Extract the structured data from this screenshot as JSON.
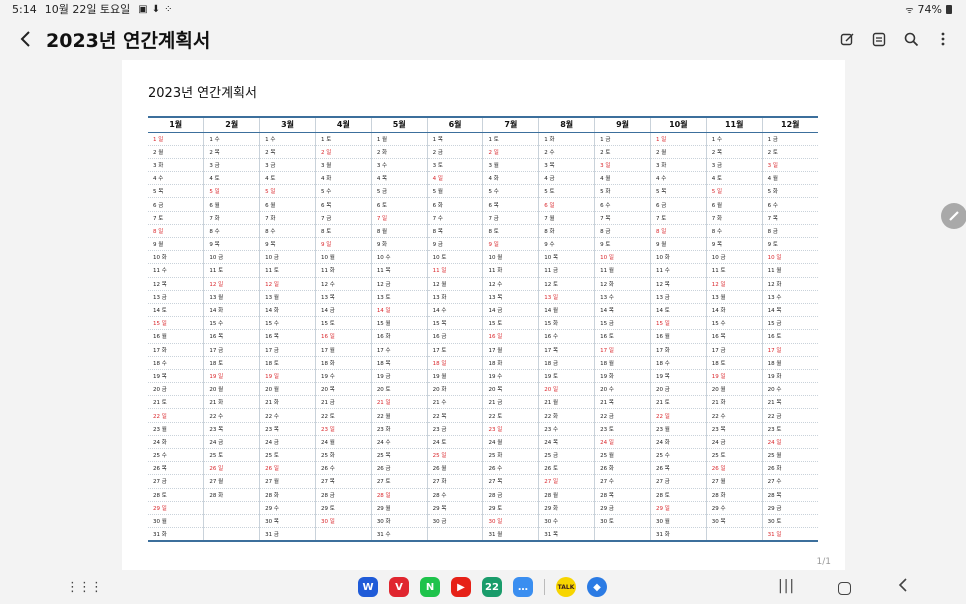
{
  "status": {
    "time": "5:14",
    "date": "10월 22일 토요일",
    "battery": "74%"
  },
  "app_bar": {
    "title": "2023년 연간계획서"
  },
  "document": {
    "title": "2023년  연간계획서",
    "page_indicator": "1/1"
  },
  "calendar": {
    "months": [
      "1월",
      "2월",
      "3월",
      "4월",
      "5월",
      "6월",
      "7월",
      "8월",
      "9월",
      "10월",
      "11월",
      "12월"
    ],
    "rows": [
      [
        "1 일",
        "1 수",
        "1 수",
        "1 토",
        "1 월",
        "1 목",
        "1 토",
        "1 화",
        "1 금",
        "1 일",
        "1 수",
        "1 금"
      ],
      [
        "2 월",
        "2 목",
        "2 목",
        "2 일",
        "2 화",
        "2 금",
        "2 일",
        "2 수",
        "2 토",
        "2 월",
        "2 목",
        "2 토"
      ],
      [
        "3 화",
        "3 금",
        "3 금",
        "3 월",
        "3 수",
        "3 토",
        "3 월",
        "3 목",
        "3 일",
        "3 화",
        "3 금",
        "3 일"
      ],
      [
        "4 수",
        "4 토",
        "4 토",
        "4 화",
        "4 목",
        "4 일",
        "4 화",
        "4 금",
        "4 월",
        "4 수",
        "4 토",
        "4 월"
      ],
      [
        "5 목",
        "5 일",
        "5 일",
        "5 수",
        "5 금",
        "5 월",
        "5 수",
        "5 토",
        "5 화",
        "5 목",
        "5 일",
        "5 화"
      ],
      [
        "6 금",
        "6 월",
        "6 월",
        "6 목",
        "6 토",
        "6 화",
        "6 목",
        "6 일",
        "6 수",
        "6 금",
        "6 월",
        "6 수"
      ],
      [
        "7 토",
        "7 화",
        "7 화",
        "7 금",
        "7 일",
        "7 수",
        "7 금",
        "7 월",
        "7 목",
        "7 토",
        "7 화",
        "7 목"
      ],
      [
        "8 일",
        "8 수",
        "8 수",
        "8 토",
        "8 월",
        "8 목",
        "8 토",
        "8 화",
        "8 금",
        "8 일",
        "8 수",
        "8 금"
      ],
      [
        "9 월",
        "9 목",
        "9 목",
        "9 일",
        "9 화",
        "9 금",
        "9 일",
        "9 수",
        "9 토",
        "9 월",
        "9 목",
        "9 토"
      ],
      [
        "10 화",
        "10 금",
        "10 금",
        "10 월",
        "10 수",
        "10 토",
        "10 월",
        "10 목",
        "10 일",
        "10 화",
        "10 금",
        "10 일"
      ],
      [
        "11 수",
        "11 토",
        "11 토",
        "11 화",
        "11 목",
        "11 일",
        "11 화",
        "11 금",
        "11 월",
        "11 수",
        "11 토",
        "11 월"
      ],
      [
        "12 목",
        "12 일",
        "12 일",
        "12 수",
        "12 금",
        "12 월",
        "12 수",
        "12 토",
        "12 화",
        "12 목",
        "12 일",
        "12 화"
      ],
      [
        "13 금",
        "13 월",
        "13 월",
        "13 목",
        "13 토",
        "13 화",
        "13 목",
        "13 일",
        "13 수",
        "13 금",
        "13 월",
        "13 수"
      ],
      [
        "14 토",
        "14 화",
        "14 화",
        "14 금",
        "14 일",
        "14 수",
        "14 금",
        "14 월",
        "14 목",
        "14 토",
        "14 화",
        "14 목"
      ],
      [
        "15 일",
        "15 수",
        "15 수",
        "15 토",
        "15 월",
        "15 목",
        "15 토",
        "15 화",
        "15 금",
        "15 일",
        "15 수",
        "15 금"
      ],
      [
        "16 월",
        "16 목",
        "16 목",
        "16 일",
        "16 화",
        "16 금",
        "16 일",
        "16 수",
        "16 토",
        "16 월",
        "16 목",
        "16 토"
      ],
      [
        "17 화",
        "17 금",
        "17 금",
        "17 월",
        "17 수",
        "17 토",
        "17 월",
        "17 목",
        "17 일",
        "17 화",
        "17 금",
        "17 일"
      ],
      [
        "18 수",
        "18 토",
        "18 토",
        "18 화",
        "18 목",
        "18 일",
        "18 화",
        "18 금",
        "18 월",
        "18 수",
        "18 토",
        "18 월"
      ],
      [
        "19 목",
        "19 일",
        "19 일",
        "19 수",
        "19 금",
        "19 월",
        "19 수",
        "19 토",
        "19 화",
        "19 목",
        "19 일",
        "19 화"
      ],
      [
        "20 금",
        "20 월",
        "20 월",
        "20 목",
        "20 토",
        "20 화",
        "20 목",
        "20 일",
        "20 수",
        "20 금",
        "20 월",
        "20 수"
      ],
      [
        "21 토",
        "21 화",
        "21 화",
        "21 금",
        "21 일",
        "21 수",
        "21 금",
        "21 월",
        "21 목",
        "21 토",
        "21 화",
        "21 목"
      ],
      [
        "22 일",
        "22 수",
        "22 수",
        "22 토",
        "22 월",
        "22 목",
        "22 토",
        "22 화",
        "22 금",
        "22 일",
        "22 수",
        "22 금"
      ],
      [
        "23 월",
        "23 목",
        "23 목",
        "23 일",
        "23 화",
        "23 금",
        "23 일",
        "23 수",
        "23 토",
        "23 월",
        "23 목",
        "23 토"
      ],
      [
        "24 화",
        "24 금",
        "24 금",
        "24 월",
        "24 수",
        "24 토",
        "24 월",
        "24 목",
        "24 일",
        "24 화",
        "24 금",
        "24 일"
      ],
      [
        "25 수",
        "25 토",
        "25 토",
        "25 화",
        "25 목",
        "25 일",
        "25 화",
        "25 금",
        "25 월",
        "25 수",
        "25 토",
        "25 월"
      ],
      [
        "26 목",
        "26 일",
        "26 일",
        "26 수",
        "26 금",
        "26 월",
        "26 수",
        "26 토",
        "26 화",
        "26 목",
        "26 일",
        "26 화"
      ],
      [
        "27 금",
        "27 월",
        "27 월",
        "27 목",
        "27 토",
        "27 화",
        "27 목",
        "27 일",
        "27 수",
        "27 금",
        "27 월",
        "27 수"
      ],
      [
        "28 토",
        "28 화",
        "28 화",
        "28 금",
        "28 일",
        "28 수",
        "28 금",
        "28 월",
        "28 목",
        "28 토",
        "28 화",
        "28 목"
      ],
      [
        "29 일",
        "",
        "29 수",
        "29 토",
        "29 월",
        "29 목",
        "29 토",
        "29 화",
        "29 금",
        "29 일",
        "29 수",
        "29 금"
      ],
      [
        "30 월",
        "",
        "30 목",
        "30 일",
        "30 화",
        "30 금",
        "30 일",
        "30 수",
        "30 토",
        "30 월",
        "30 목",
        "30 토"
      ],
      [
        "31 화",
        "",
        "31 금",
        "",
        "31 수",
        "",
        "31 월",
        "31 목",
        "",
        "31 화",
        "",
        "31 일"
      ]
    ],
    "holiday_color": "#d9262b"
  },
  "dock": {
    "apps": [
      {
        "icon": "w-app-icon",
        "label": "W",
        "color": "#1f5bd8"
      },
      {
        "icon": "v-app-icon",
        "label": "V",
        "color": "#e0262f"
      },
      {
        "icon": "naver-icon",
        "label": "N",
        "color": "#1ec34b"
      },
      {
        "icon": "youtube-icon",
        "label": "▶",
        "color": "#e62117"
      },
      {
        "icon": "calendar-app-icon",
        "label": "22",
        "color": "#1a9c6b"
      },
      {
        "icon": "messages-icon",
        "label": "…",
        "color": "#3a8ef0"
      }
    ],
    "apps_after_sep": [
      {
        "icon": "kakaotalk-icon",
        "label": "TALK",
        "color": "#f7d500"
      },
      {
        "icon": "browser-icon",
        "label": "◆",
        "color": "#2b7be4"
      }
    ]
  }
}
